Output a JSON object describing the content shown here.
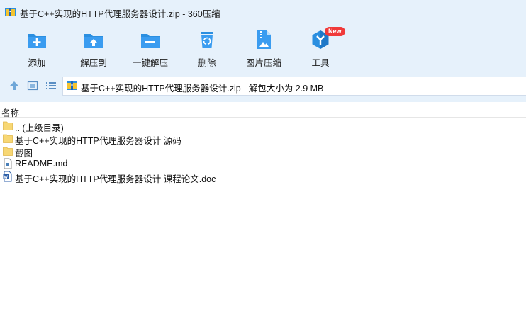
{
  "window": {
    "title": "基于C++实现的HTTP代理服务器设计.zip - 360压缩"
  },
  "toolbar": {
    "buttons": [
      {
        "label": "添加",
        "icon": "add-icon"
      },
      {
        "label": "解压到",
        "icon": "extract-to-icon"
      },
      {
        "label": "一键解压",
        "icon": "one-click-extract-icon"
      },
      {
        "label": "删除",
        "icon": "delete-icon"
      },
      {
        "label": "图片压缩",
        "icon": "image-compress-icon"
      },
      {
        "label": "工具",
        "icon": "tools-icon",
        "badge": "New"
      }
    ]
  },
  "address": {
    "text": "基于C++实现的HTTP代理服务器设计.zip - 解包大小为 2.9 MB"
  },
  "list": {
    "column_name": "名称",
    "items": [
      {
        "name": ".. (上级目录)",
        "type": "folder"
      },
      {
        "name": "基于C++实现的HTTP代理服务器设计 源码",
        "type": "folder"
      },
      {
        "name": "截图",
        "type": "folder"
      },
      {
        "name": "README.md",
        "type": "md-file"
      },
      {
        "name": "基于C++实现的HTTP代理服务器设计 课程论文.doc",
        "type": "word-file"
      }
    ]
  },
  "colors": {
    "chrome_bg": "#e6f1fb",
    "icon_blue": "#2b8fe0",
    "folder_yellow": "#f7d774",
    "badge_red": "#f03a3a"
  }
}
